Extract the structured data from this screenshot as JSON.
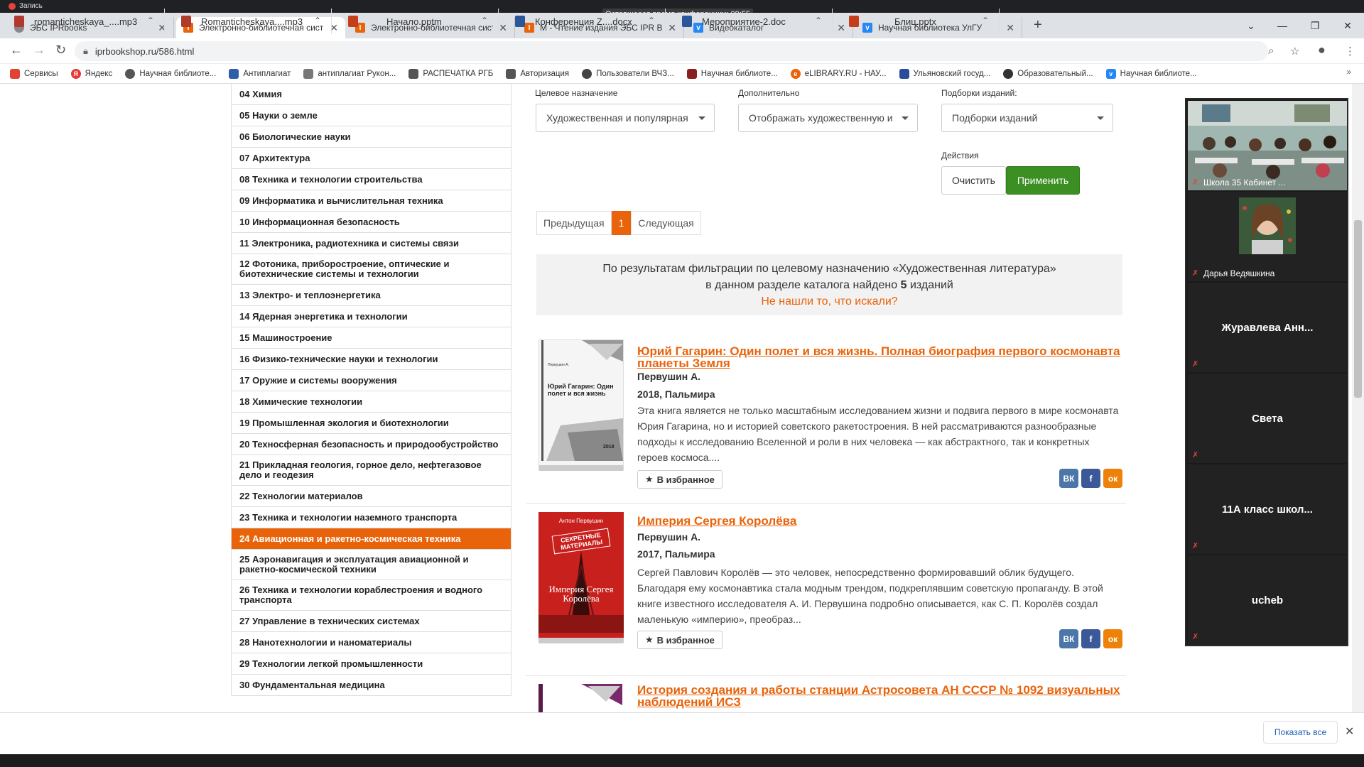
{
  "recording": {
    "label": "Запись"
  },
  "conference_timer": "Оставшееся время конференции: 09:55",
  "tabs": [
    {
      "title": "ЭБС IPRbooks",
      "icon": "globe-icon"
    },
    {
      "title": "Электронно-библиотечная сист",
      "icon": "iprbooks-icon"
    },
    {
      "title": "Электронно-библиотечная сист",
      "icon": "iprbooks-icon"
    },
    {
      "title": "М - Чтение издания ЭБС IPR BO",
      "icon": "iprbooks-icon"
    },
    {
      "title": "Видеокаталог",
      "icon": "vk-icon"
    },
    {
      "title": "Научная библиотека УлГУ",
      "icon": "vk-icon"
    }
  ],
  "url": "iprbookshop.ru/586.html",
  "bookmarks": [
    {
      "label": "Сервисы",
      "color": "#e34133"
    },
    {
      "label": "Яндекс",
      "color": "#e53935"
    },
    {
      "label": "Научная библиоте...",
      "color": "#555555"
    },
    {
      "label": "Антиплагиат",
      "color": "#2f5ea8"
    },
    {
      "label": "антиплагиат Рукон...",
      "color": "#777777"
    },
    {
      "label": "РАСПЕЧАТКА РГБ",
      "color": "#555555"
    },
    {
      "label": "Авторизация",
      "color": "#555555"
    },
    {
      "label": "Пользователи ВЧЗ...",
      "color": "#444444"
    },
    {
      "label": "Научная библиоте...",
      "color": "#8b1e1e"
    },
    {
      "label": "eLIBRARY.RU - НАУ...",
      "color": "#e8630a"
    },
    {
      "label": "Ульяновский госуд...",
      "color": "#2a4d9b"
    },
    {
      "label": "Образовательный...",
      "color": "#333333"
    },
    {
      "label": "Научная библиоте...",
      "color": "#2787f5"
    }
  ],
  "categories": [
    "04 Химия",
    "05 Науки о земле",
    "06 Биологические науки",
    "07 Архитектура",
    "08 Техника и технологии строительства",
    "09 Информатика и вычислительная техника",
    "10 Информационная безопасность",
    "11 Электроника, радиотехника и системы связи",
    "12 Фотоника, приборостроение, оптические и биотехнические системы и технологии",
    "13 Электро- и теплоэнергетика",
    "14 Ядерная энергетика и технологии",
    "15 Машиностроение",
    "16 Физико-технические науки и технологии",
    "17 Оружие и системы вооружения",
    "18 Химические технологии",
    "19 Промышленная экология и биотехнологии",
    "20 Техносферная безопасность и природообустройство",
    "21 Прикладная геология, горное дело, нефтегазовое дело и геодезия",
    "22 Технологии материалов",
    "23 Техника и технологии наземного транспорта",
    "24 Авиационная и ракетно-космическая техника",
    "25 Аэронавигация и эксплуатация авиационной и ракетно-космической техники",
    "26 Техника и технологии кораблестроения и водного транспорта",
    "27 Управление в технических системах",
    "28 Нанотехнологии и наноматериалы",
    "29 Технологии легкой промышленности",
    "30 Фундаментальная медицина"
  ],
  "active_category": "24 Авиационная и ракетно-космическая техника",
  "filters": {
    "purpose_label": "Целевое назначение",
    "purpose_value": "Художественная и популярная",
    "extra_label": "Дополнительно",
    "extra_value": "Отображать художественную и",
    "collections_label": "Подборки изданий:",
    "collections_value": "Подборки изданий",
    "actions_label": "Действия",
    "clear": "Очистить",
    "apply": "Применить"
  },
  "pager": {
    "prev": "Предыдущая",
    "current": "1",
    "next": "Следующая"
  },
  "info": {
    "line1": "По результатам фильтрации по целевому назначению «Художественная литература»",
    "line2_pre": "в данном разделе каталога найдено",
    "count": "5",
    "line2_post": "изданий",
    "link": "Не нашли то, что искали?"
  },
  "books": [
    {
      "title": "Юрий Гагарин: Один полет и вся жизнь. Полная биография первого космонавта планеты Земля",
      "author": "Первушин А.",
      "year": "2018, Пальмира",
      "desc": "Эта книга является не только масштабным исследованием жизни и подвига первого в мире космонавта Юрия Гагарина, но и историей советского ракетостроения. В ней рассматриваются разнообразные подходы к исследованию Вселенной и роли в них человека — как абстрактного, так и конкретных героев космоса....",
      "favorite": "В избранное",
      "cover_text": "Юрий Гагарин: Один полет и вся жизнь",
      "cover_author": "Первушин А.",
      "cover_year": "2018"
    },
    {
      "title": "Империя Сергея Королёва",
      "author": "Первушин А.",
      "year": "2017, Пальмира",
      "desc": "Сергей Павлович Королёв — это человек, непосредственно формировавший облик будущего. Благодаря ему космонавтика стала модным трендом, подкреплявшим советскую пропаганду. В этой книге известного исследователя А. И. Первушина подробно описывается, как С. П. Королёв создал маленькую «империю», преобраз...",
      "favorite": "В избранное",
      "cover_author": "Антон Первушин",
      "cover_top": "СЕКРЕТНЫЕ МАТЕРИАЛЫ",
      "cover_title": "Империя Сергея Королёва"
    },
    {
      "title": "История создания и работы станции Астросовета АН СССР № 1092 визуальных наблюдений ИСЗ"
    }
  ],
  "social": {
    "vk": "ВК",
    "fb": "f",
    "ok": "ок"
  },
  "participants": [
    {
      "name": "Школа 35 Кабинет ...",
      "type": "video"
    },
    {
      "name": "Дарья Ведяшкина",
      "type": "avatar"
    },
    {
      "name": "Журавлева Анн...",
      "type": "name"
    },
    {
      "name": "Света",
      "type": "name"
    },
    {
      "name": "11А класс школ...",
      "type": "name"
    },
    {
      "name": "ucheb",
      "type": "name"
    }
  ],
  "downloads": [
    {
      "name": "romanticheskaya_....mp3",
      "color": "#b03a2e"
    },
    {
      "name": "Romanticheskaya....mp3",
      "color": "#b03a2e"
    },
    {
      "name": "Начало.pptm",
      "color": "#c43e1c"
    },
    {
      "name": "Конференция Z....docx",
      "color": "#2b579a"
    },
    {
      "name": "Мероприятие-2.doc",
      "color": "#2b579a"
    },
    {
      "name": "Блиц.pptx",
      "color": "#c43e1c"
    }
  ],
  "show_all": "Показать все"
}
